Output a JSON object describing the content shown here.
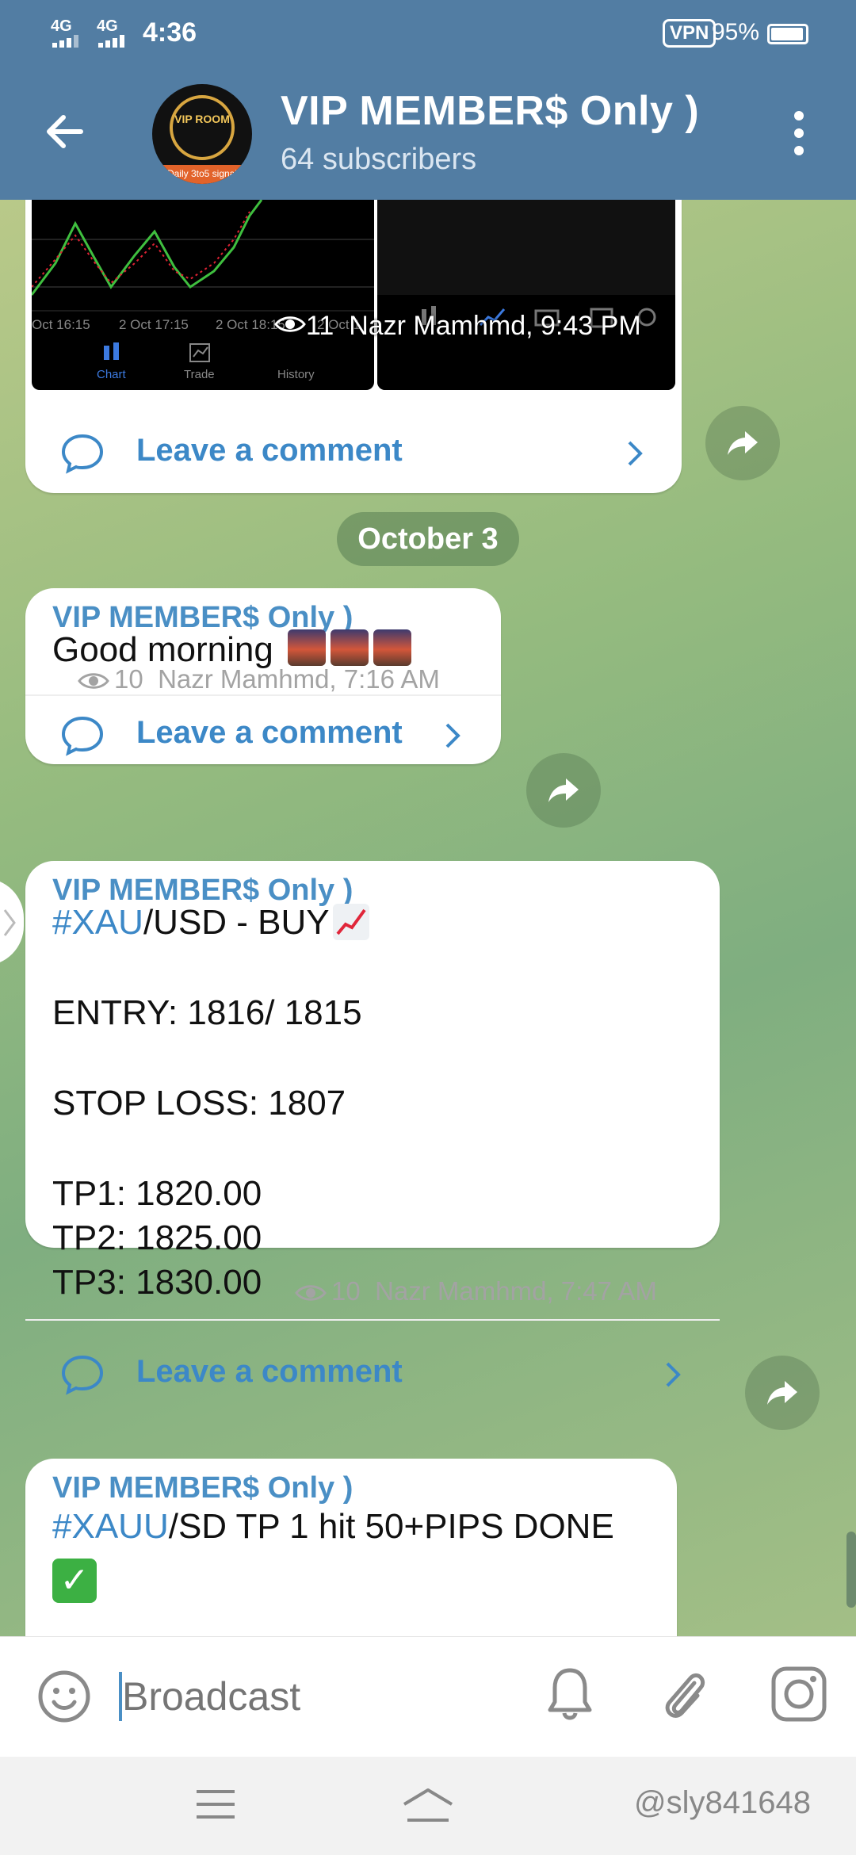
{
  "status_bar": {
    "net1": "4G",
    "net2": "4G",
    "time": "4:36",
    "vpn": "VPN",
    "battery": "95%"
  },
  "header": {
    "title": "VIP MEMBER$ Only )",
    "subtitle": "64 subscribers",
    "avatar_top_text": "VIP ROOM",
    "avatar_band_text": "Daily 3to5 signal"
  },
  "chart_post": {
    "tick_labels": [
      "Oct 16:15",
      "2 Oct 17:15",
      "2 Oct 18:15",
      "2 Oct 1"
    ],
    "tab_labels": [
      "Chart",
      "Trade",
      "History"
    ],
    "views": "11",
    "author_time": "Nazr Mamhmd, 9:43 PM",
    "comment_label": "Leave a comment"
  },
  "date_separator": "October 3",
  "messages": [
    {
      "sender": "VIP MEMBER$ Only )",
      "text": "Good morning",
      "views": "10",
      "author_time": "Nazr Mamhmd, 7:16 AM",
      "comment_label": "Leave a comment"
    },
    {
      "sender": "VIP MEMBER$ Only )",
      "hashtag": "#XAU",
      "title_rest": "/USD - BUY",
      "entry": "ENTRY: 1816/ 1815",
      "stop_loss": "STOP LOSS: 1807",
      "tp1": "TP1: 1820.00",
      "tp2": "TP2: 1825.00",
      "tp3": "TP3: 1830.00",
      "views": "10",
      "author_time": "Nazr Mamhmd, 7:47 AM",
      "comment_label": "Leave a comment"
    },
    {
      "sender": "VIP MEMBER$ Only )",
      "hashtag": "#XAUU",
      "text_rest": "/SD TP 1 hit 50+PIPS DONE"
    }
  ],
  "input": {
    "placeholder": "Broadcast"
  },
  "watermark": "@sly841648",
  "icons": {
    "back": "arrow-left-icon",
    "more": "more-vertical-icon",
    "eye": "eye-icon",
    "comment": "comment-bubble-icon",
    "share": "share-arrow-icon",
    "emoji": "smile-icon",
    "bell": "bell-icon",
    "attach": "paperclip-icon",
    "camera": "instagram-camera-icon"
  },
  "colors": {
    "header_bg": "#527da3",
    "accent": "#4a8fc5",
    "link": "#3c88c7"
  }
}
